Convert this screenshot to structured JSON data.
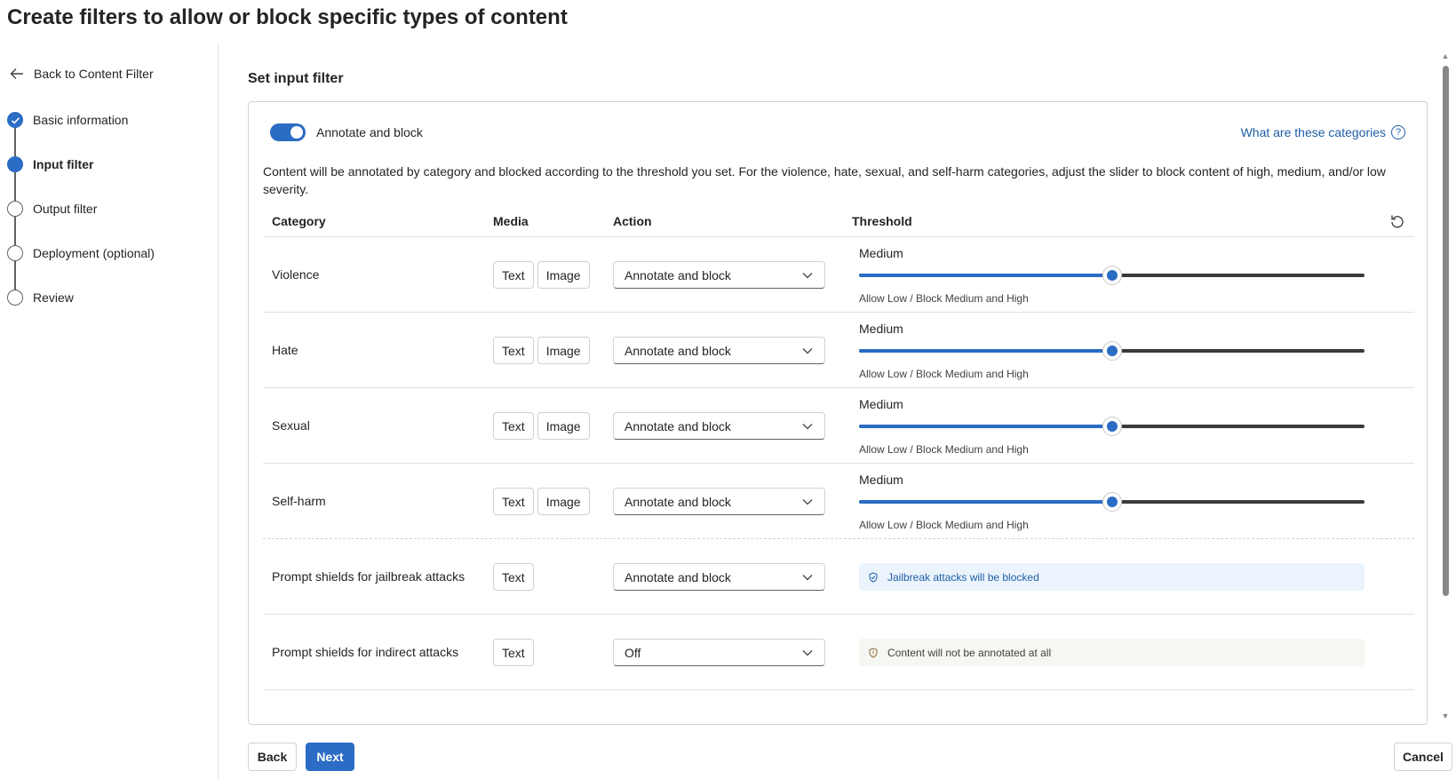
{
  "page": {
    "title": "Create filters to allow or block specific types of content"
  },
  "nav": {
    "back_label": "Back to Content Filter",
    "steps": [
      {
        "label": "Basic information",
        "state": "done"
      },
      {
        "label": "Input filter",
        "state": "active"
      },
      {
        "label": "Output filter",
        "state": "pending"
      },
      {
        "label": "Deployment (optional)",
        "state": "pending"
      },
      {
        "label": "Review",
        "state": "pending"
      }
    ]
  },
  "main": {
    "section_title": "Set input filter",
    "toggle": {
      "label": "Annotate and block",
      "on": true
    },
    "help_link": "What are these categories",
    "description": "Content will be annotated by category and blocked according to the threshold you set. For the violence, hate, sexual, and self-harm categories, adjust the slider to block content of high, medium, and/or low severity.",
    "columns": {
      "category": "Category",
      "media": "Media",
      "action": "Action",
      "threshold": "Threshold"
    },
    "rows": [
      {
        "category": "Violence",
        "media": [
          "Text",
          "Image"
        ],
        "action": "Annotate and block",
        "threshold_label": "Medium",
        "threshold_level": 0.5,
        "threshold_caption": "Allow Low / Block Medium and High"
      },
      {
        "category": "Hate",
        "media": [
          "Text",
          "Image"
        ],
        "action": "Annotate and block",
        "threshold_label": "Medium",
        "threshold_level": 0.5,
        "threshold_caption": "Allow Low / Block Medium and High"
      },
      {
        "category": "Sexual",
        "media": [
          "Text",
          "Image"
        ],
        "action": "Annotate and block",
        "threshold_label": "Medium",
        "threshold_level": 0.5,
        "threshold_caption": "Allow Low / Block Medium and High"
      },
      {
        "category": "Self-harm",
        "media": [
          "Text",
          "Image"
        ],
        "action": "Annotate and block",
        "threshold_label": "Medium",
        "threshold_level": 0.5,
        "threshold_caption": "Allow Low / Block Medium and High"
      },
      {
        "category": "Prompt shields for jailbreak attacks",
        "media": [
          "Text"
        ],
        "action": "Annotate and block",
        "notice": "Jailbreak attacks will be blocked",
        "notice_kind": "info"
      },
      {
        "category": "Prompt shields for indirect attacks",
        "media": [
          "Text"
        ],
        "action": "Off",
        "notice": "Content will not be annotated at all",
        "notice_kind": "muted"
      }
    ]
  },
  "footer": {
    "back_label": "Back",
    "next_label": "Next",
    "cancel_label": "Cancel"
  },
  "colors": {
    "accent": "#2b6cc4",
    "link": "#1f5fa8",
    "track": "#3b3a39",
    "info_bg": "#ebf3fc"
  }
}
